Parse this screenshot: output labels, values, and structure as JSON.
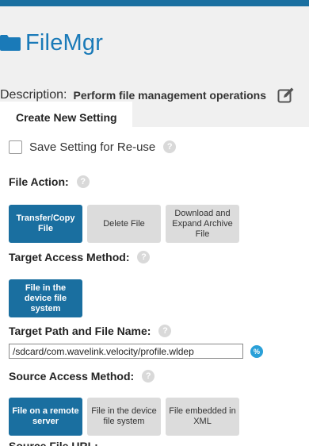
{
  "app": {
    "title": "FileMgr",
    "description_label": "Description:",
    "description_value": "Perform file management operations"
  },
  "tabs": [
    {
      "label": "Create New Setting"
    }
  ],
  "save_setting": {
    "label": "Save Setting for Re-use",
    "checked": false
  },
  "file_action": {
    "label": "File Action:",
    "options": [
      {
        "label": "Transfer/Copy File",
        "selected": true
      },
      {
        "label": "Delete File",
        "selected": false
      },
      {
        "label": "Download and Expand Archive File",
        "selected": false
      }
    ]
  },
  "target_access_method": {
    "label": "Target Access Method:",
    "options": [
      {
        "label": "File in the device file system",
        "selected": true
      }
    ]
  },
  "target_path": {
    "label": "Target Path and File Name:",
    "value": "/sdcard/com.wavelink.velocity/profile.wldep",
    "var_icon_text": "%"
  },
  "source_access_method": {
    "label": "Source Access Method:",
    "options": [
      {
        "label": "File on a remote server",
        "selected": true
      },
      {
        "label": "File in the device file system",
        "selected": false
      },
      {
        "label": "File embedded in XML",
        "selected": false
      }
    ]
  },
  "source_file_url": {
    "label": "Source File URL:"
  },
  "help_icon_text": "?",
  "colors": {
    "accent": "#1a6fa0",
    "title": "#1a7ab8",
    "header_bg": "#f0f0f0",
    "button_inactive": "#dcdcdc",
    "help_icon": "#d9d9d9",
    "var_icon": "#2aa0d8"
  },
  "icons": {
    "app": "folder-icon",
    "edit": "edit-icon",
    "help": "help-icon",
    "variable": "percent-icon"
  }
}
